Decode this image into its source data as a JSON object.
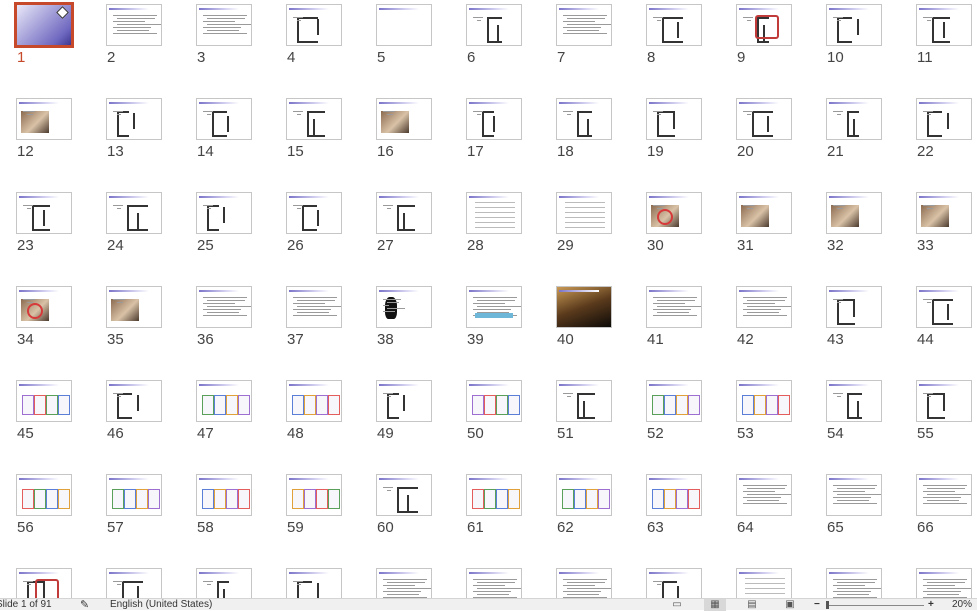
{
  "slides": [
    {
      "n": "1",
      "kind": "title",
      "selected": true
    },
    {
      "n": "2",
      "kind": "text"
    },
    {
      "n": "3",
      "kind": "text"
    },
    {
      "n": "4",
      "kind": "diagram"
    },
    {
      "n": "5",
      "kind": "blank"
    },
    {
      "n": "6",
      "kind": "diagram"
    },
    {
      "n": "7",
      "kind": "text"
    },
    {
      "n": "8",
      "kind": "diagram"
    },
    {
      "n": "9",
      "kind": "diagram-red"
    },
    {
      "n": "10",
      "kind": "diagram"
    },
    {
      "n": "11",
      "kind": "diagram"
    },
    {
      "n": "12",
      "kind": "photo"
    },
    {
      "n": "13",
      "kind": "diagram"
    },
    {
      "n": "14",
      "kind": "diagram"
    },
    {
      "n": "15",
      "kind": "diagram"
    },
    {
      "n": "16",
      "kind": "photo"
    },
    {
      "n": "17",
      "kind": "diagram"
    },
    {
      "n": "18",
      "kind": "diagram"
    },
    {
      "n": "19",
      "kind": "diagram"
    },
    {
      "n": "20",
      "kind": "diagram"
    },
    {
      "n": "21",
      "kind": "diagram"
    },
    {
      "n": "22",
      "kind": "diagram"
    },
    {
      "n": "23",
      "kind": "diagram"
    },
    {
      "n": "24",
      "kind": "diagram"
    },
    {
      "n": "25",
      "kind": "diagram"
    },
    {
      "n": "26",
      "kind": "diagram"
    },
    {
      "n": "27",
      "kind": "diagram"
    },
    {
      "n": "28",
      "kind": "table"
    },
    {
      "n": "29",
      "kind": "table"
    },
    {
      "n": "30",
      "kind": "photo-red"
    },
    {
      "n": "31",
      "kind": "photo"
    },
    {
      "n": "32",
      "kind": "photo"
    },
    {
      "n": "33",
      "kind": "photo"
    },
    {
      "n": "34",
      "kind": "photo-red"
    },
    {
      "n": "35",
      "kind": "photo"
    },
    {
      "n": "36",
      "kind": "text"
    },
    {
      "n": "37",
      "kind": "text"
    },
    {
      "n": "38",
      "kind": "silhouette"
    },
    {
      "n": "39",
      "kind": "text-blue"
    },
    {
      "n": "40",
      "kind": "dark-photo"
    },
    {
      "n": "41",
      "kind": "text"
    },
    {
      "n": "42",
      "kind": "text"
    },
    {
      "n": "43",
      "kind": "diagram"
    },
    {
      "n": "44",
      "kind": "diagram"
    },
    {
      "n": "45",
      "kind": "color-table"
    },
    {
      "n": "46",
      "kind": "diagram"
    },
    {
      "n": "47",
      "kind": "color-table"
    },
    {
      "n": "48",
      "kind": "color-table"
    },
    {
      "n": "49",
      "kind": "diagram"
    },
    {
      "n": "50",
      "kind": "color-table"
    },
    {
      "n": "51",
      "kind": "diagram"
    },
    {
      "n": "52",
      "kind": "color-table"
    },
    {
      "n": "53",
      "kind": "color-table"
    },
    {
      "n": "54",
      "kind": "diagram"
    },
    {
      "n": "55",
      "kind": "diagram"
    },
    {
      "n": "56",
      "kind": "color-table"
    },
    {
      "n": "57",
      "kind": "color-table"
    },
    {
      "n": "58",
      "kind": "color-table"
    },
    {
      "n": "59",
      "kind": "color-table"
    },
    {
      "n": "60",
      "kind": "diagram"
    },
    {
      "n": "61",
      "kind": "color-table"
    },
    {
      "n": "62",
      "kind": "color-table"
    },
    {
      "n": "63",
      "kind": "color-table"
    },
    {
      "n": "64",
      "kind": "text"
    },
    {
      "n": "65",
      "kind": "text"
    },
    {
      "n": "66",
      "kind": "text"
    },
    {
      "n": "",
      "kind": "diagram-red"
    },
    {
      "n": "",
      "kind": "diagram"
    },
    {
      "n": "",
      "kind": "diagram"
    },
    {
      "n": "",
      "kind": "diagram"
    },
    {
      "n": "",
      "kind": "text"
    },
    {
      "n": "",
      "kind": "text"
    },
    {
      "n": "",
      "kind": "text"
    },
    {
      "n": "",
      "kind": "diagram"
    },
    {
      "n": "",
      "kind": "table"
    },
    {
      "n": "",
      "kind": "text"
    },
    {
      "n": "",
      "kind": "text"
    }
  ],
  "status": {
    "slide_info": "Slide 1 of 91",
    "language": "English (United States)",
    "zoom": "20%",
    "zoom_minus": "−",
    "zoom_plus": "+"
  },
  "colors": {
    "selection": "#c5492a",
    "accent": "#7b74c9"
  }
}
